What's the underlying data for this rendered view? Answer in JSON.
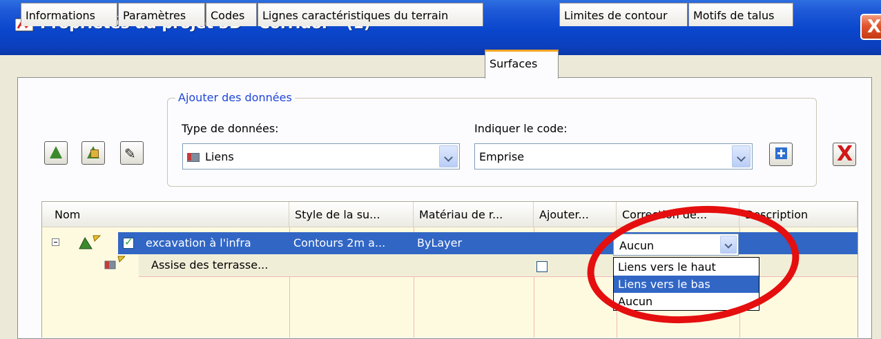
{
  "window": {
    "title": "Propriétés du projet 3D - Corridor - (1)",
    "close_label": "X"
  },
  "tabs": [
    {
      "label": "Informations"
    },
    {
      "label": "Paramètres"
    },
    {
      "label": "Codes"
    },
    {
      "label": "Lignes caractéristiques du terrain"
    },
    {
      "label": "Surfaces"
    },
    {
      "label": "Limites de contour"
    },
    {
      "label": "Motifs de talus"
    }
  ],
  "active_tab": "Surfaces",
  "add_data": {
    "legend": "Ajouter des données",
    "data_type_label": "Type de données:",
    "data_type_value": "Liens",
    "code_label": "Indiquer le code:",
    "code_value": "Emprise"
  },
  "grid": {
    "columns": [
      "Nom",
      "Style de la su...",
      "Matériau de r...",
      "Ajouter...",
      "Correction de...",
      "Description"
    ],
    "rows": [
      {
        "name": "excavation à l'infra",
        "style": "Contours 2m a...",
        "material": "ByLayer",
        "checked": true
      },
      {
        "name": "Assise des terrasse...",
        "style": "",
        "material": "",
        "checked": false
      }
    ],
    "correction_value": "Aucun",
    "dropdown_options": [
      "Liens vers le haut",
      "Liens vers le bas",
      "Aucun"
    ],
    "dropdown_selected": "Liens vers le bas"
  },
  "colors": {
    "titlebar": "#0a46cc",
    "selection": "#3166c5",
    "highlight_ellipse": "#e50f0f"
  }
}
